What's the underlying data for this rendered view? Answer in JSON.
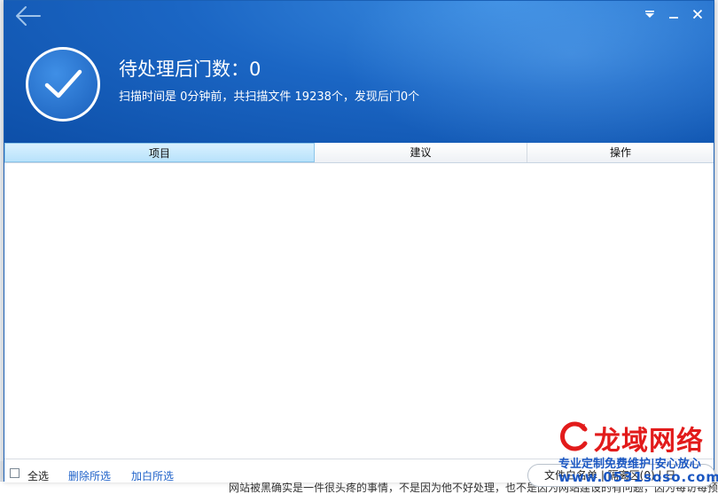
{
  "header": {
    "headline": "待处理后门数：0",
    "summary": "扫描时间是 0分钟前，共扫描文件 19238个，发现后门0个"
  },
  "table": {
    "columns": [
      "项目",
      "建议",
      "操作"
    ]
  },
  "footer": {
    "select_all": "全选",
    "delete_selected": "删除所选",
    "whitelist_selected": "加白所选",
    "whitelist_button": "文件白名单 | 隔离区(0) | 日"
  },
  "background": {
    "article_snippet": "网站被黑确实是一件很头疼的事情，不是因为他不好处理，也不是因为网站建设的有问题，因为每访每预"
  },
  "watermark": {
    "brand": "龙域网络",
    "tagline": "专业定制免费维护|安心放心",
    "url": "www.0531soso.com"
  },
  "colors": {
    "header_blue": "#1b66c4",
    "active_tab": "#b8e2fb",
    "link": "#1f62c9",
    "brand_red": "#e21b1b"
  },
  "icons": {
    "back": "arrow-left-icon",
    "menu": "triangle-down-icon",
    "minimize": "minimize-icon",
    "close": "close-icon",
    "status": "checkmark-icon"
  }
}
